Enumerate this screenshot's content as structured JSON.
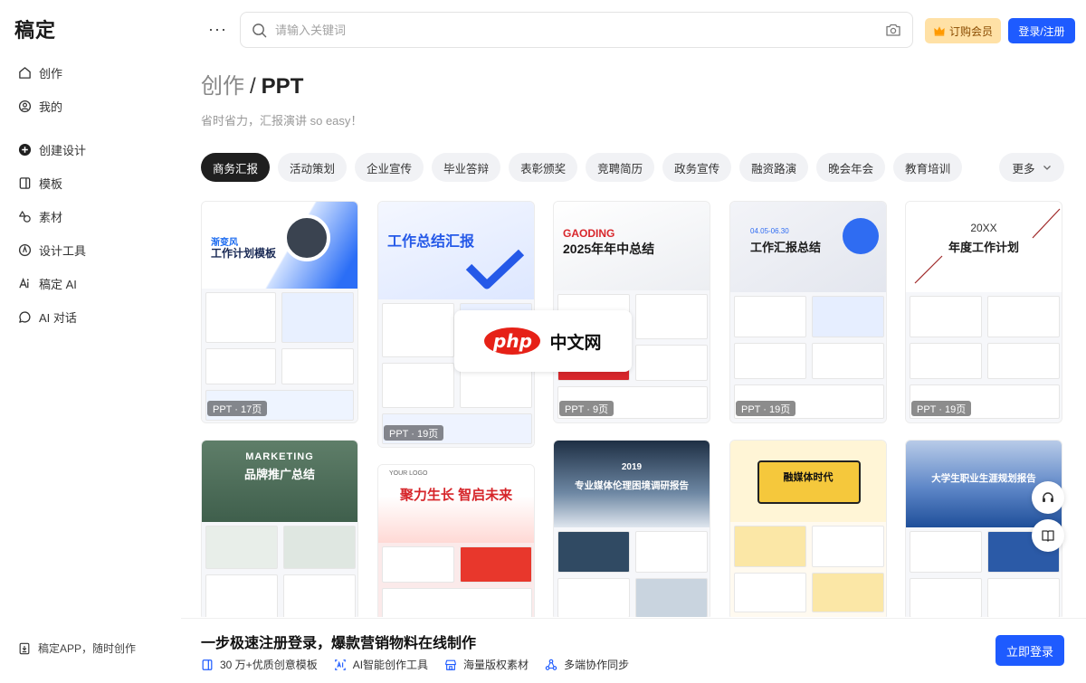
{
  "app": {
    "logo": "稿定"
  },
  "sidebar": {
    "items": [
      {
        "label": "创作",
        "icon": "home-icon"
      },
      {
        "label": "我的",
        "icon": "user-icon"
      },
      {
        "label": "创建设计",
        "icon": "plus-circle-icon"
      },
      {
        "label": "模板",
        "icon": "template-icon"
      },
      {
        "label": "素材",
        "icon": "shapes-icon"
      },
      {
        "label": "设计工具",
        "icon": "compass-icon"
      },
      {
        "label": "稿定 AI",
        "icon": "ai-pen-icon"
      },
      {
        "label": "AI 对话",
        "icon": "chat-icon"
      }
    ],
    "app_promo": "稿定APP，随时创作"
  },
  "header": {
    "more": "···",
    "search_placeholder": "请输入关键词",
    "vip_label": "订购会员",
    "login_label": "登录/注册"
  },
  "page": {
    "category": "创作",
    "separator": "/",
    "subcategory": "PPT",
    "subtitle": "省时省力，汇报演讲 so easy！"
  },
  "tabs": [
    "商务汇报",
    "活动策划",
    "企业宣传",
    "毕业答辩",
    "表彰颁奖",
    "竞聘简历",
    "政务宣传",
    "融资路演",
    "晚会年会",
    "教育培训"
  ],
  "tab_more": "更多",
  "cards": [
    {
      "title": "工作计划模板",
      "kicker": "渐变风",
      "badge": "PPT · 17页",
      "accent": "#1d6cf0"
    },
    {
      "title": "工作总结汇报",
      "kicker": "",
      "badge": "PPT · 19页",
      "accent": "#2559e8"
    },
    {
      "title": "2025年年中总结",
      "kicker": "GAODING",
      "badge": "PPT · 9页",
      "accent": "#d8262b"
    },
    {
      "title": "工作汇报总结",
      "kicker": "04.05-06.30",
      "badge": "PPT · 19页",
      "accent": "#2f6cf2"
    },
    {
      "title": "年度工作计划",
      "kicker": "20XX",
      "badge": "PPT · 19页",
      "accent": "#a02a2a"
    },
    {
      "title": "品牌推广总结",
      "kicker": "MARKETING",
      "badge": "",
      "accent": "#3f5f4c"
    },
    {
      "title": "聚力生长 智启未来",
      "kicker": "YOUR LOGO",
      "badge": "",
      "accent": "#d6252a"
    },
    {
      "title": "专业媒体伦理困境调研报告",
      "kicker": "2019",
      "badge": "",
      "accent": "#304a63"
    },
    {
      "title": "融媒体时代",
      "kicker": "",
      "badge": "",
      "accent": "#f5c83c"
    },
    {
      "title": "大学生职业生涯规划报告",
      "kicker": "",
      "badge": "",
      "accent": "#2b5aa7"
    }
  ],
  "watermark": {
    "logo": "php",
    "text": "中文网"
  },
  "banner": {
    "title": "一步极速注册登录，爆款营销物料在线制作",
    "features": [
      "30 万+优质创意模板",
      "AI智能创作工具",
      "海量版权素材",
      "多端协作同步"
    ],
    "cta": "立即登录"
  }
}
